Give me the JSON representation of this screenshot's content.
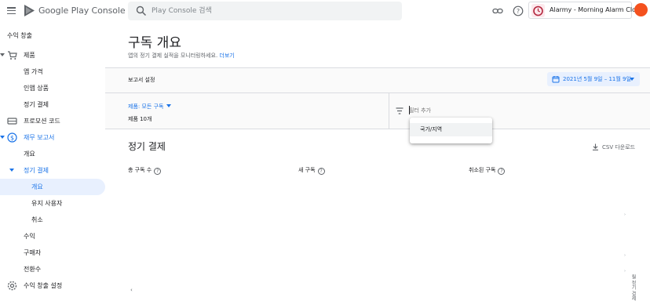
{
  "header": {
    "app_title": "Google Play Console",
    "search_placeholder": "Play Console 검색",
    "selected_app": "Alarmy - Morning Alarm Clock"
  },
  "sidebar": {
    "section_title": "수익 창출",
    "items": [
      {
        "label": "제품"
      },
      {
        "label": "앱 가격"
      },
      {
        "label": "인앱 상품"
      },
      {
        "label": "정기 결제"
      },
      {
        "label": "프로모션 코드"
      },
      {
        "label": "재무 보고서"
      },
      {
        "label": "개요"
      },
      {
        "label": "정기 결제"
      },
      {
        "label": "개요"
      },
      {
        "label": "유지 사용자"
      },
      {
        "label": "취소"
      },
      {
        "label": "수익"
      },
      {
        "label": "구매자"
      },
      {
        "label": "전환수"
      },
      {
        "label": "수익 창출 설정"
      }
    ]
  },
  "main": {
    "title": "구독 개요",
    "subtitle": "앱의 정기 결제 실적을 모니터링하세요.",
    "learn_more": "더보기",
    "report_settings": "보고서 설정",
    "date_range": "2021년 5월 9일 – 11월 9일",
    "product_filter": "제품: 모든 구독",
    "product_count": "제품 10개",
    "filter_placeholder": "필터 추가",
    "filter_option": "국가/지역",
    "section_title": "정기 결제",
    "csv_download": "CSV 다운로드",
    "metrics": [
      "총 구독 수",
      "새 구독",
      "취소된 구독"
    ],
    "pager_left": "‹",
    "side_ticks": [
      "›",
      "›",
      "›"
    ],
    "vertical_label": "월 정기 결제"
  },
  "colors": {
    "accent": "#1a73e8",
    "active_bg": "#e8f0fe",
    "avatar": "#f4511e"
  }
}
